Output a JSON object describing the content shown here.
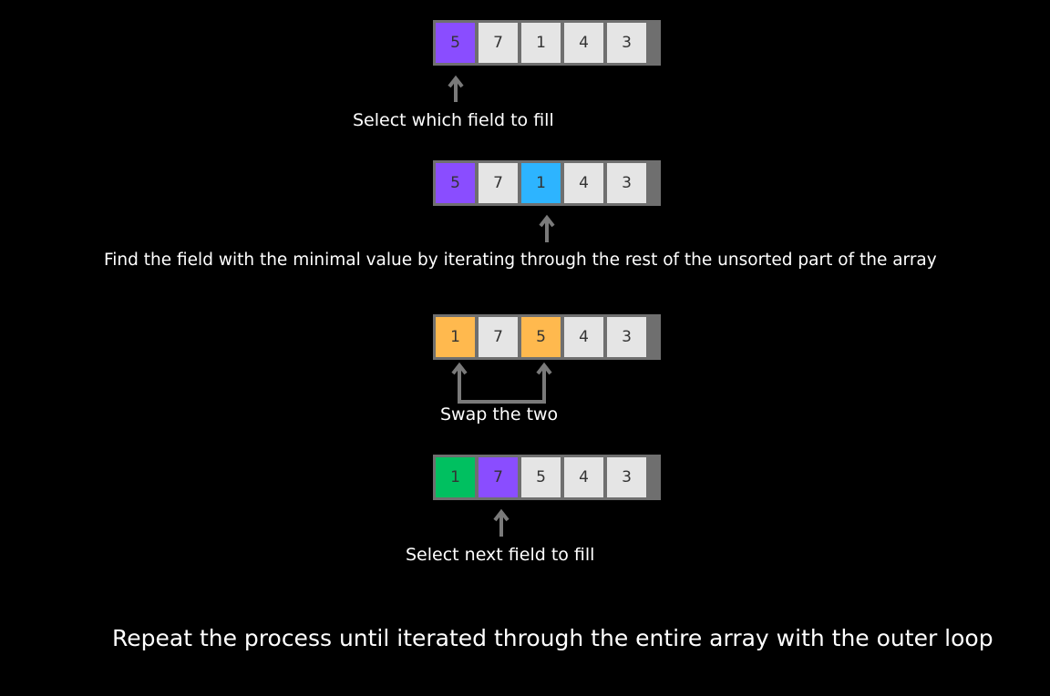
{
  "colors": {
    "background": "#000000",
    "border": "#6f6f6f",
    "default": "#e5e5e5",
    "selected": "#8a4dff",
    "minimum": "#2db4ff",
    "swap": "#ffb94e",
    "sorted": "#00c060",
    "arrow": "#7a7a7a"
  },
  "steps": [
    {
      "cells": [
        {
          "value": "5",
          "state": "selected"
        },
        {
          "value": "7",
          "state": "default"
        },
        {
          "value": "1",
          "state": "default"
        },
        {
          "value": "4",
          "state": "default"
        },
        {
          "value": "3",
          "state": "default"
        }
      ],
      "caption": "Select which field to fill"
    },
    {
      "cells": [
        {
          "value": "5",
          "state": "selected"
        },
        {
          "value": "7",
          "state": "default"
        },
        {
          "value": "1",
          "state": "minimum"
        },
        {
          "value": "4",
          "state": "default"
        },
        {
          "value": "3",
          "state": "default"
        }
      ],
      "caption": "Find the field with the minimal value by iterating through the rest of the unsorted part of the array"
    },
    {
      "cells": [
        {
          "value": "1",
          "state": "swap"
        },
        {
          "value": "7",
          "state": "default"
        },
        {
          "value": "5",
          "state": "swap"
        },
        {
          "value": "4",
          "state": "default"
        },
        {
          "value": "3",
          "state": "default"
        }
      ],
      "caption": "Swap the two"
    },
    {
      "cells": [
        {
          "value": "1",
          "state": "sorted"
        },
        {
          "value": "7",
          "state": "selected"
        },
        {
          "value": "5",
          "state": "default"
        },
        {
          "value": "4",
          "state": "default"
        },
        {
          "value": "3",
          "state": "default"
        }
      ],
      "caption": "Select next field to fill"
    }
  ],
  "footer": "Repeat the process until iterated through the entire array with the outer loop"
}
